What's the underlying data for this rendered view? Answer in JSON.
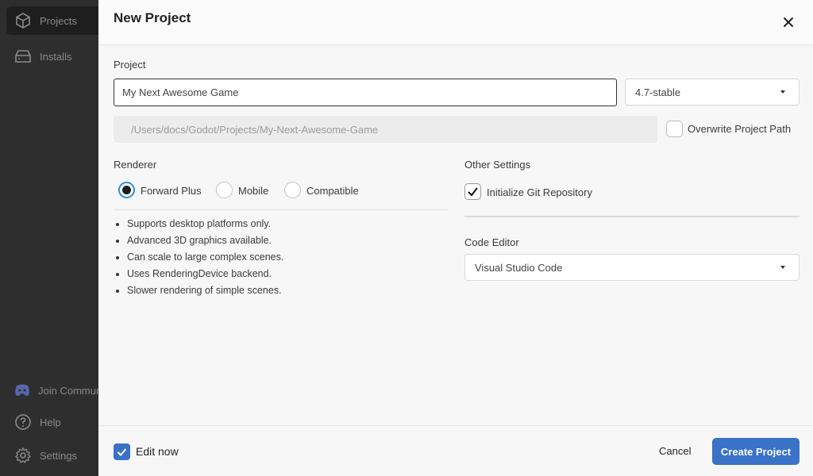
{
  "sidebar": {
    "items": [
      {
        "label": "Projects",
        "icon": "cube-icon"
      },
      {
        "label": "Installs",
        "icon": "drive-icon"
      },
      {
        "label": "Join Community",
        "icon": "discord-icon"
      },
      {
        "label": "Help",
        "icon": "help-icon"
      },
      {
        "label": "Settings",
        "icon": "gear-icon"
      }
    ]
  },
  "modal": {
    "title": "New Project",
    "project_label": "Project",
    "project_name": "My Next Awesome Game",
    "version": "4.7-stable",
    "project_path": "/Users/docs/Godot/Projects/My-Next-Awesome-Game",
    "overwrite_label": "Overwrite Project Path",
    "overwrite_checked": false,
    "renderer_label": "Renderer",
    "renderers": [
      {
        "label": "Forward Plus",
        "selected": true
      },
      {
        "label": "Mobile",
        "selected": false
      },
      {
        "label": "Compatible",
        "selected": false
      }
    ],
    "renderer_notes": [
      "Supports desktop platforms only.",
      "Advanced 3D graphics available.",
      "Can scale to large complex scenes.",
      "Uses RenderingDevice backend.",
      "Slower rendering of simple scenes."
    ],
    "other_settings_label": "Other Settings",
    "init_git_label": "Initialize Git Repository",
    "init_git_checked": true,
    "code_editor_label": "Code Editor",
    "code_editor": "Visual Studio Code"
  },
  "footer": {
    "edit_now_label": "Edit now",
    "edit_now_checked": true,
    "cancel_label": "Cancel",
    "create_label": "Create Project"
  },
  "colors": {
    "accent": "#3a72c8",
    "radio_ring": "#2a8fd6",
    "sidebar_bg": "#2e2e2e"
  }
}
